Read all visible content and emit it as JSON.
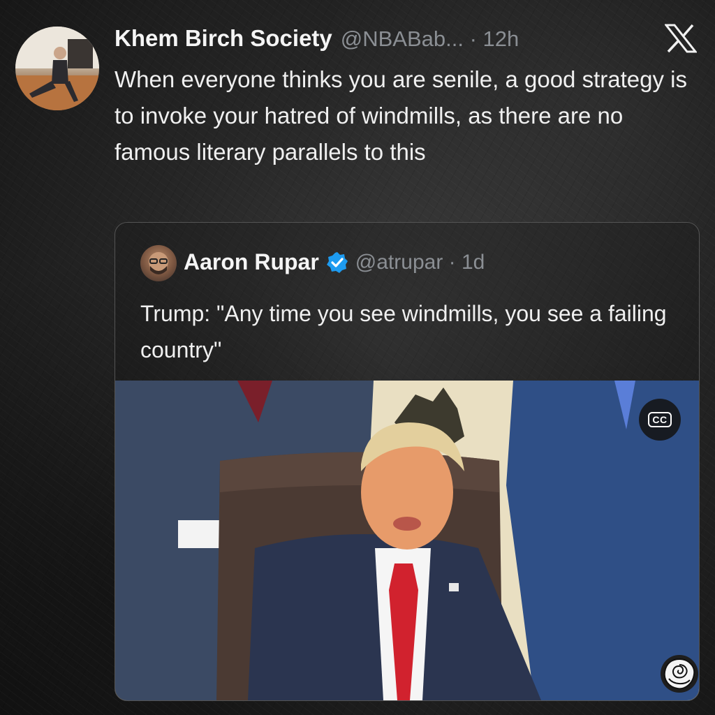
{
  "tweet": {
    "display_name": "Khem Birch Society",
    "handle_time": "@NBABab... · 12h",
    "text": "When everyone thinks you are senile, a good strategy is to invoke your hatred of windmills, as there are no famous literary parallels to this"
  },
  "quoted_tweet": {
    "display_name": "Aaron Rupar",
    "handle_time": "@atrupar · 1d",
    "text": "Trump: \"Any time you see windmills, you see a failing country\"",
    "media": {
      "cc_label": "CC"
    }
  },
  "icons": {
    "platform_logo": "x-logo-icon",
    "verified": "verified-badge-icon",
    "captions": "closed-captions-icon",
    "watermark": "rose-icon"
  },
  "colors": {
    "background": "#1e1e1e",
    "text_primary": "#f0f0f0",
    "text_secondary": "#8b8f94",
    "verified_blue": "#1d9bf0",
    "card_border": "#545454"
  }
}
